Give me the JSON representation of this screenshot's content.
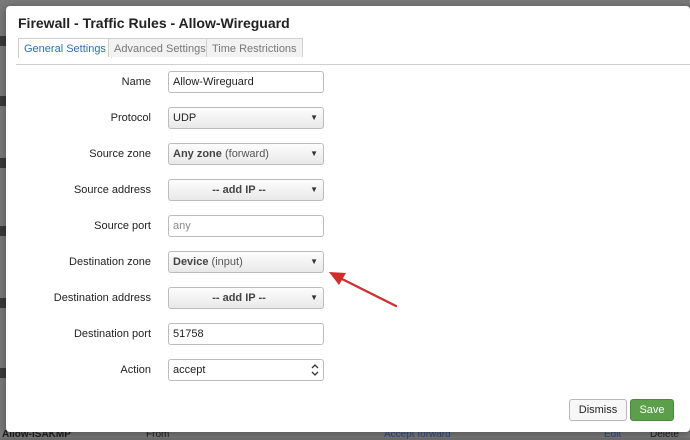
{
  "background": {
    "row_name": "Allow-ISAKMP",
    "row_from": "From",
    "row_action": "Accept forward",
    "row_edit": "Edit",
    "row_delete": "Delete"
  },
  "modal": {
    "title": "Firewall - Traffic Rules - Allow-Wireguard",
    "tabs": [
      {
        "label": "General Settings",
        "active": true
      },
      {
        "label": "Advanced Settings",
        "active": false
      },
      {
        "label": "Time Restrictions",
        "active": false
      }
    ],
    "fields": {
      "name": {
        "label": "Name",
        "value": "Allow-Wireguard"
      },
      "protocol": {
        "label": "Protocol",
        "value": "UDP"
      },
      "source_zone": {
        "label": "Source zone",
        "value": "Any zone",
        "suffix": "(forward)"
      },
      "source_address": {
        "label": "Source address",
        "value": "-- add IP --"
      },
      "source_port": {
        "label": "Source port",
        "placeholder": "any"
      },
      "destination_zone": {
        "label": "Destination zone",
        "value": "Device",
        "suffix": "(input)"
      },
      "destination_address": {
        "label": "Destination address",
        "value": "-- add IP --"
      },
      "destination_port": {
        "label": "Destination port",
        "value": "51758"
      },
      "action": {
        "label": "Action",
        "value": "accept"
      }
    },
    "buttons": {
      "dismiss": "Dismiss",
      "save": "Save"
    }
  },
  "colors": {
    "tab_active_text": "#2a6fb6",
    "save_button": "#5b9f4b",
    "annotation_arrow": "#d42b2b"
  },
  "annotation": {
    "shape": "arrow",
    "points_to": "destination-zone-select"
  }
}
